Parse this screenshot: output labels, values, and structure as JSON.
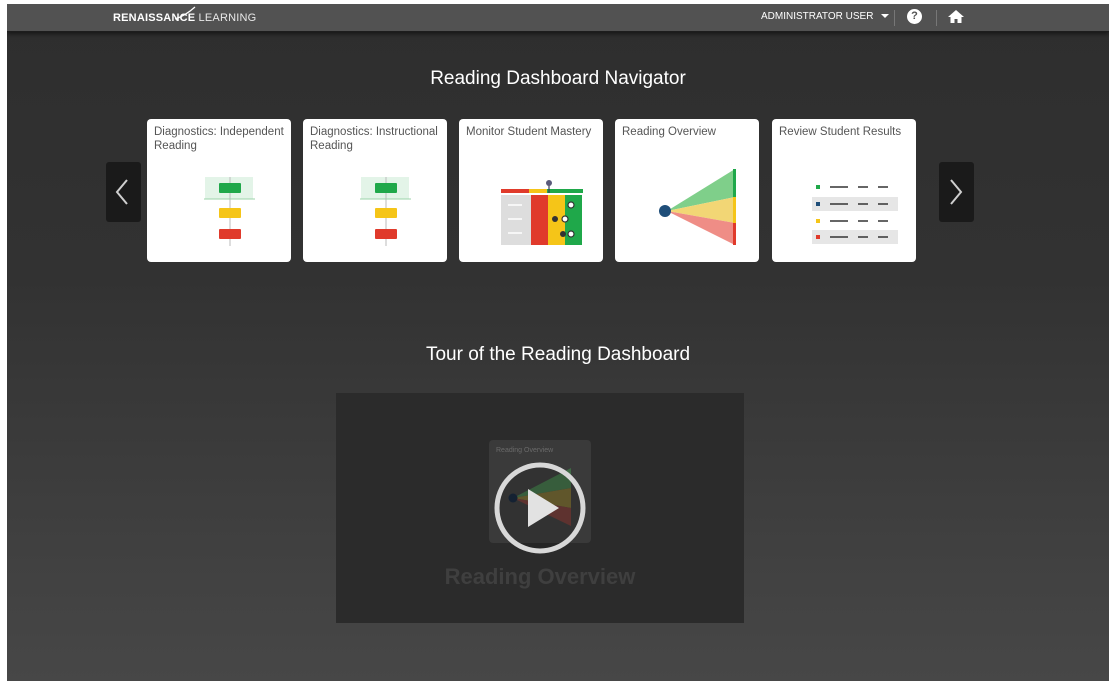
{
  "header": {
    "logo_brand": "RENAISSANCE",
    "logo_brand2": "LEARNING",
    "user_label": "ADMINISTRATOR USER",
    "help_glyph": "?"
  },
  "navigator": {
    "title": "Reading Dashboard Navigator",
    "cards": [
      {
        "label": "Diagnostics: Independent Reading",
        "icon": "diagnostics-bars-icon"
      },
      {
        "label": "Diagnostics: Instructional Reading",
        "icon": "diagnostics-bars-icon"
      },
      {
        "label": "Monitor Student Mastery",
        "icon": "mastery-grid-icon"
      },
      {
        "label": "Reading Overview",
        "icon": "overview-fan-icon"
      },
      {
        "label": "Review Student Results",
        "icon": "results-list-icon"
      }
    ]
  },
  "tour": {
    "title": "Tour of the Reading Dashboard",
    "thumb_label": "Reading Overview",
    "caption": "Reading Overview"
  },
  "colors": {
    "green": "#1fa84a",
    "yellow": "#f5c518",
    "red": "#e03a2b",
    "blue": "#1f4e79"
  }
}
